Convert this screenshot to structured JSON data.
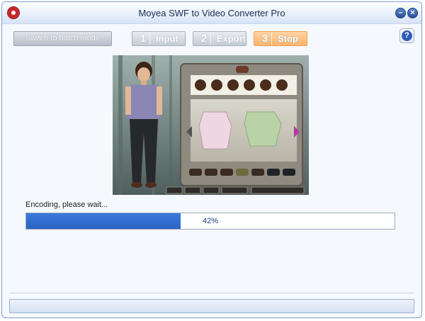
{
  "window": {
    "title": "Moyea SWF to Video Converter Pro"
  },
  "toolbar": {
    "batch_mode_label": "Switch to batch mode",
    "steps": [
      {
        "num": "1",
        "label": "Input"
      },
      {
        "num": "2",
        "label": "Export"
      },
      {
        "num": "3",
        "label": "Stop"
      }
    ],
    "help_label": "?"
  },
  "preview": {
    "bottom_buttons": [
      "",
      "",
      "",
      "",
      ""
    ]
  },
  "status": {
    "message": "Encoding, please wait..."
  },
  "progress": {
    "value": 0.42,
    "label": "42%"
  },
  "colors": {
    "accent": "#2a63c4",
    "active_step": "#f9b36b"
  },
  "icons": {
    "app": "app-logo-icon",
    "minimize": "minimize-icon",
    "close": "close-icon",
    "help": "help-icon"
  }
}
